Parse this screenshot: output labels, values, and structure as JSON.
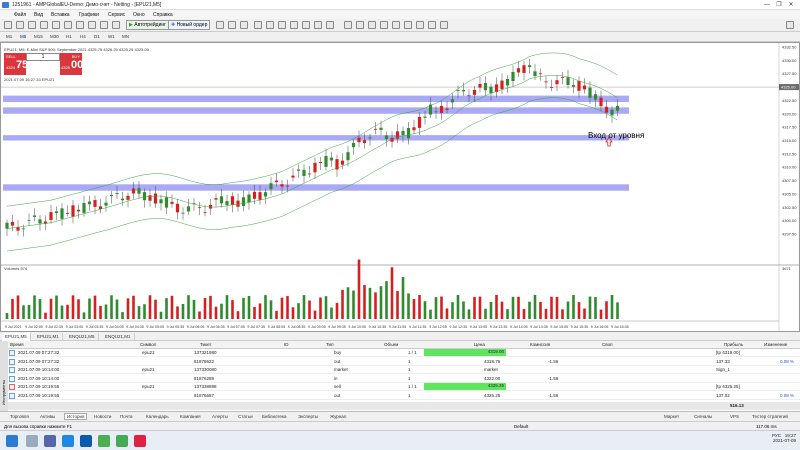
{
  "window": {
    "title": "1251961 - AMPGlobalEU-Demo: Демо-счет - Netting - [EPU21,M5]",
    "min": "—",
    "max": "❐",
    "close": "✕"
  },
  "menu": [
    "Файл",
    "Вид",
    "Вставка",
    "Графики",
    "Сервис",
    "Окно",
    "Справка"
  ],
  "toolbar": {
    "algo_label": "Автотрейдинг",
    "neworder_label": "Новый ордер"
  },
  "timeframes": [
    "M1",
    "M5",
    "M15",
    "M30",
    "H1",
    "H4",
    "D1",
    "W1",
    "MN"
  ],
  "chart": {
    "info": "EPU21, M5: E-Mini S&P 500: September 2021 4325.75 4326.25 4325.25 4325.00",
    "info2": "2021.07.09 16:27:33 EPU21",
    "sell_label": "SELL",
    "buy_label": "BUY",
    "qty": "1",
    "sell_price_small": "4324",
    "sell_price_big": "75",
    "buy_price_small": "4325",
    "buy_price_big": "00",
    "annotation": "Вход от уровня",
    "volume_label": "Volumes 574",
    "price_ticks": [
      "4332.50",
      "4330.00",
      "4327.50",
      "4325.00",
      "4322.50",
      "4320.00",
      "4317.50",
      "4315.00",
      "4312.50",
      "4310.00",
      "4307.50",
      "4305.00",
      "4302.50",
      "4300.00",
      "4297.50"
    ],
    "last_price": "4325.00",
    "vol_tick": "3671",
    "time_ticks": [
      "9 Jul 2021",
      "9 Jul 02:05",
      "9 Jul 02:35",
      "9 Jul 03:05",
      "9 Jul 03:35",
      "9 Jul 04:05",
      "9 Jul 04:35",
      "9 Jul 05:05",
      "9 Jul 05:35",
      "9 Jul 06:05",
      "9 Jul 06:35",
      "9 Jul 07:05",
      "9 Jul 07:35",
      "9 Jul 08:05",
      "9 Jul 08:35",
      "9 Jul 09:05",
      "9 Jul 09:35",
      "9 Jul 10:05",
      "9 Jul 10:35",
      "9 Jul 11:05",
      "9 Jul 11:35",
      "9 Jul 12:05",
      "9 Jul 12:35",
      "9 Jul 13:05",
      "9 Jul 13:35",
      "9 Jul 14:05",
      "9 Jul 14:35",
      "9 Jul 15:05",
      "9 Jul 15:35",
      "9 Jul 16:05",
      "9 Jul 16:35"
    ]
  },
  "chart_tabs": [
    "EPU21,M5",
    "EPU21,M1",
    "ENQU21,M5",
    "ENQU21,M1"
  ],
  "terminal": {
    "headers": [
      "Время",
      "Символ",
      "Тикет",
      "ID",
      "Тип",
      "Объем",
      "Цена",
      "Комиссия",
      "Своп",
      "Прибыль",
      "Изменение"
    ],
    "rows": [
      {
        "time": "2021.07.09 07:27:32",
        "symbol": "epu21",
        "ticket": "137321980",
        "type": "buy",
        "volume": "1 / 1",
        "price": "4319.00",
        "commission": "",
        "swap": "",
        "profit": "[tp 4319.00]",
        "change": ""
      },
      {
        "time": "2021.07.09 07:27:32",
        "symbol": "",
        "ticket": "81878622",
        "type": "out",
        "volume": "1",
        "price": "4318.75",
        "commission": "-1.56",
        "swap": "",
        "profit": "137.33",
        "change": "0.08 %"
      },
      {
        "time": "2021.07.09 10:14:00",
        "symbol": "epu21",
        "ticket": "137330080",
        "type": "market",
        "volume": "1",
        "price": "market",
        "commission": "",
        "swap": "",
        "profit": "Sign_1",
        "change": ""
      },
      {
        "time": "2021.07.09 10:14:00",
        "symbol": "",
        "ticket": "81876289",
        "type": "in",
        "volume": "1",
        "price": "4322.00",
        "commission": "-1.56",
        "swap": "",
        "profit": "",
        "change": ""
      },
      {
        "time": "2021.07.09 10:19:55",
        "symbol": "epu21",
        "ticket": "137338888",
        "type": "sell",
        "volume": "1 / 1",
        "price": "4325.25",
        "commission": "",
        "swap": "",
        "profit": "[tp 4325.25]",
        "change": ""
      },
      {
        "time": "2021.07.09 10:19:55",
        "symbol": "",
        "ticket": "81876687",
        "type": "out",
        "volume": "1",
        "price": "4325.25",
        "commission": "-1.56",
        "swap": "",
        "profit": "137.02",
        "change": "0.08 %"
      }
    ],
    "summary_profit": "516.13",
    "side_label": "Инструменты"
  },
  "bottom_tabs": [
    "Торговля",
    "Активы",
    "История",
    "Новости",
    "Почта",
    "Календарь",
    "Компания",
    "Алерты",
    "Статьи",
    "Библиотека",
    "Эксперты",
    "Журнал"
  ],
  "bottom_right": [
    "Маркет",
    "Сигналы",
    "VPS",
    "Тестер стратегий"
  ],
  "status": {
    "help": "Для вызова справки нажмите F1",
    "profile": "Default",
    "conn": "117.06 ms"
  },
  "taskbar": {
    "lang": "РУС",
    "time": "19:27",
    "date": "2021-07-09"
  }
}
